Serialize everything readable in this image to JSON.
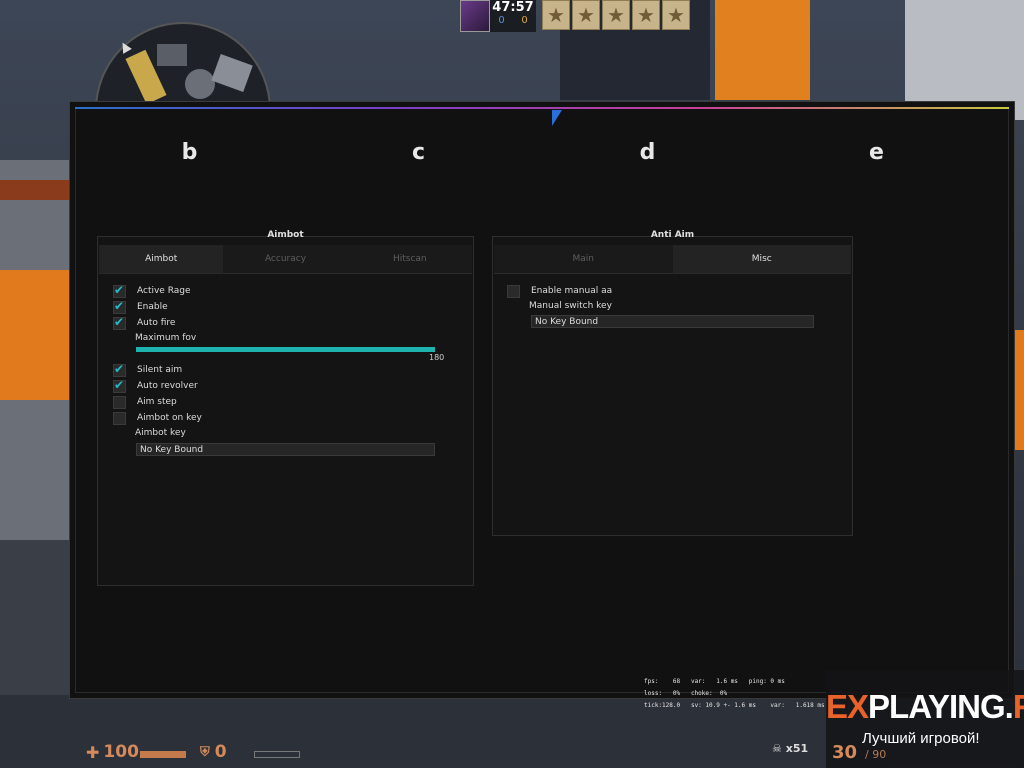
{
  "hud": {
    "timer": "47:57",
    "score_ct": "0",
    "score_t": "0",
    "health": "100",
    "armor": "0",
    "ammo": "30",
    "ammo_reserve": "/ 90",
    "kills": "x51",
    "netgraph": {
      "line1": "fps:    68   var:   1.6 ms   ping: 0 ms",
      "line2": "loss:   0%   choke:  0%",
      "line3": "tick:128.0   sv: 10.9 +- 1.6 ms    var:   1.618 ms"
    }
  },
  "menu": {
    "tabs": [
      "b",
      "c",
      "d",
      "e"
    ],
    "aimbot_group": {
      "title": "Aimbot",
      "subtabs": [
        "Aimbot",
        "Accuracy",
        "Hitscan"
      ],
      "active_subtab": "Aimbot",
      "active_rage": "Active Rage",
      "enable": "Enable",
      "auto_fire": "Auto fire",
      "maximum_fov": "Maximum fov",
      "fov_value": "180",
      "fov_fraction": 1.0,
      "silent_aim": "Silent aim",
      "auto_revolver": "Auto revolver",
      "aim_step": "Aim step",
      "aimbot_on_key": "Aimbot on key",
      "aimbot_key_label": "Aimbot key",
      "aimbot_key_value": "No Key Bound"
    },
    "antiaim_group": {
      "title": "Anti Aim",
      "subtabs": [
        "Main",
        "Misc"
      ],
      "active_subtab": "Misc",
      "enable_manual_aa": "Enable manual aa",
      "manual_switch_key_label": "Manual switch key",
      "manual_switch_key_value": "No Key Bound"
    }
  },
  "watermark": {
    "brand_ex": "EX",
    "brand_mid": "PLAYING.",
    "brand_ru": "RU",
    "tagline": "Лучший игровой!"
  },
  "colors": {
    "accent": "#1fb3b0",
    "check": "#27b9c6",
    "menu_bg": "#111111",
    "hud_orange": "#d48a5a",
    "brand_orange": "#e8622a"
  }
}
